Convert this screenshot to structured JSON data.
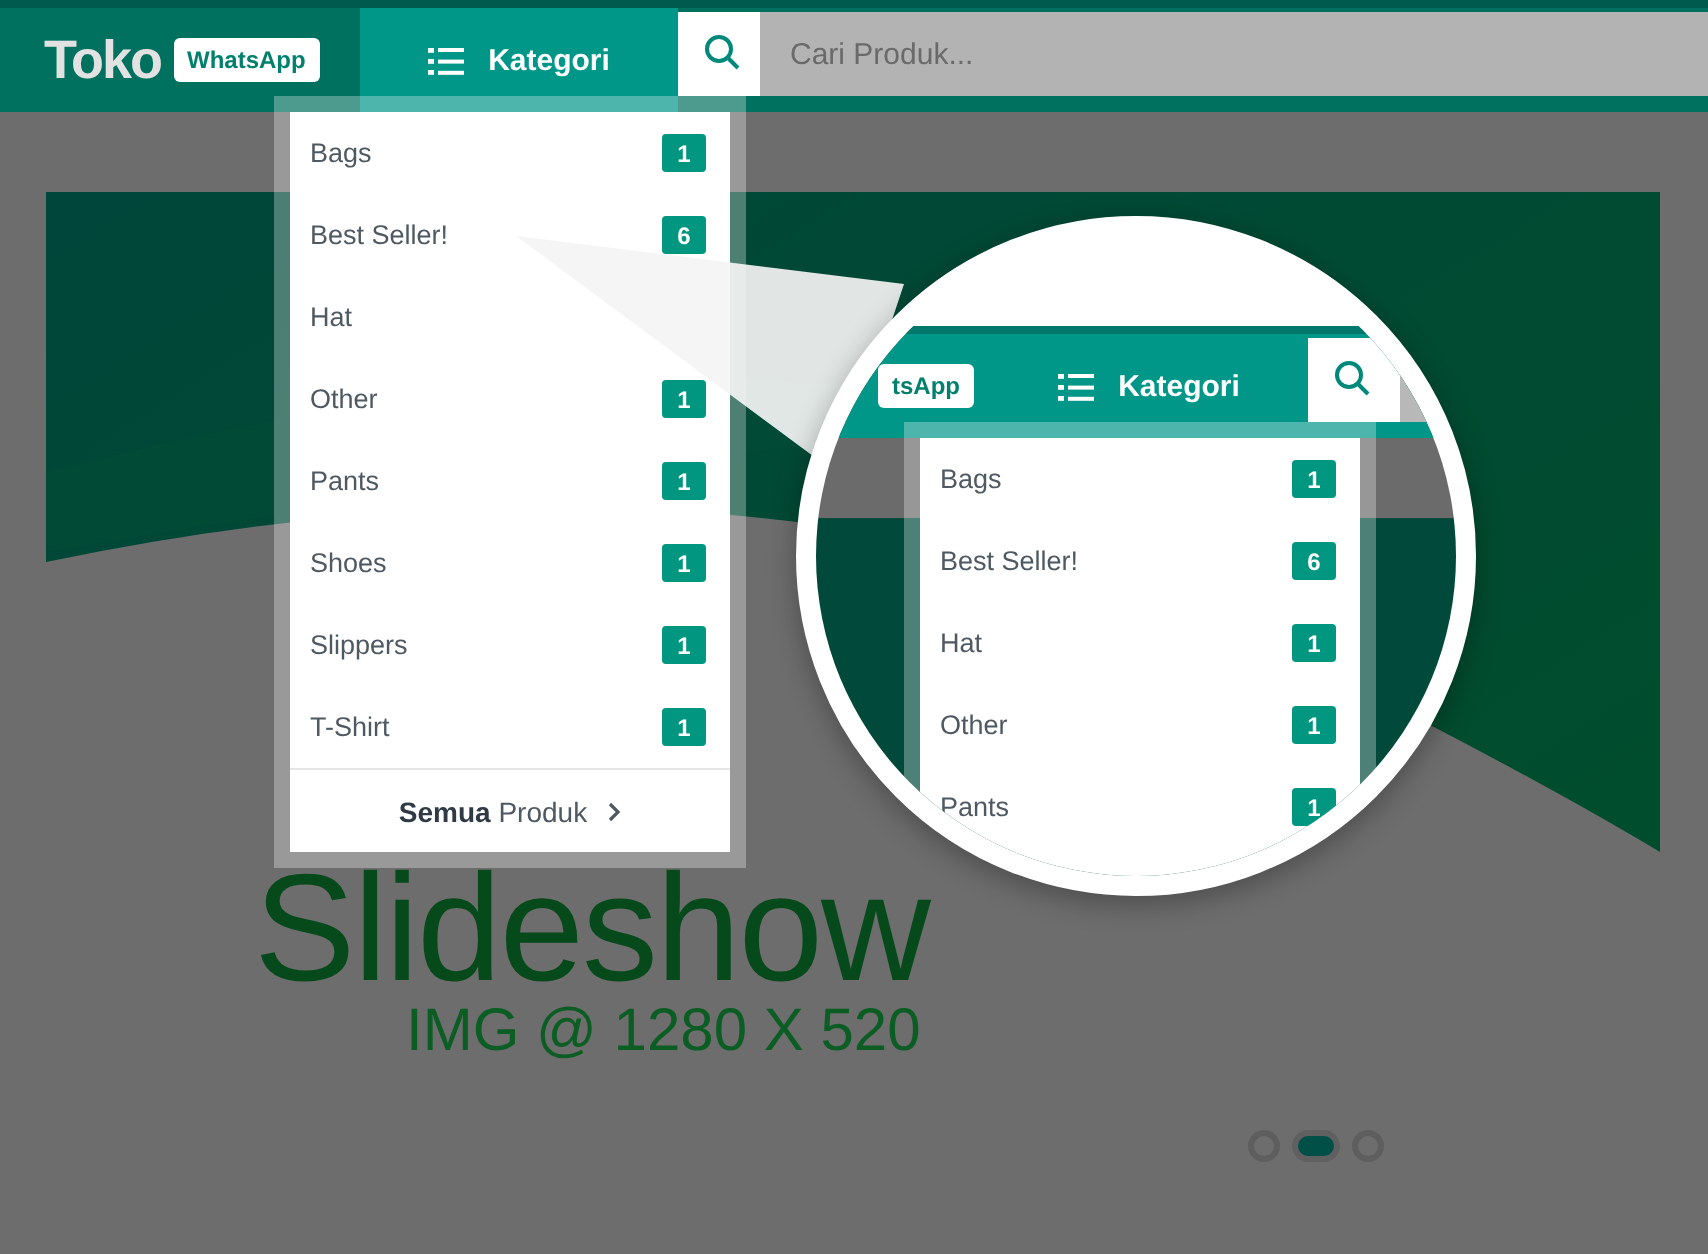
{
  "header": {
    "logo": "Toko",
    "logo_badge": "WhatsApp",
    "category_button": "Kategori",
    "search": {
      "placeholder": "Cari Produk..."
    }
  },
  "category_menu": {
    "items": [
      {
        "label": "Bags",
        "count": "1"
      },
      {
        "label": "Best Seller!",
        "count": "6"
      },
      {
        "label": "Hat"
      },
      {
        "label": "Other",
        "count": "1"
      },
      {
        "label": "Pants",
        "count": "1"
      },
      {
        "label": "Shoes",
        "count": "1"
      },
      {
        "label": "Slippers",
        "count": "1"
      },
      {
        "label": "T-Shirt",
        "count": "1"
      }
    ],
    "footer": "**Semua** Produk"
  },
  "slideshow": {
    "title": "Slideshow",
    "subtitle": "IMG @ 1280 X 520",
    "indicators": [
      {
        "selected": false
      },
      {
        "selected": true
      },
      {
        "selected": false
      }
    ]
  },
  "magnifier": {
    "logo_badge": "tsApp",
    "category_button": "Kategori",
    "items": [
      {
        "label": "Bags",
        "count": "1"
      },
      {
        "label": "Best Seller!",
        "count": "6"
      },
      {
        "label": "Hat",
        "count": "1"
      },
      {
        "label": "Other",
        "count": "1"
      },
      {
        "label": "Pants",
        "count": "1"
      }
    ]
  }
}
